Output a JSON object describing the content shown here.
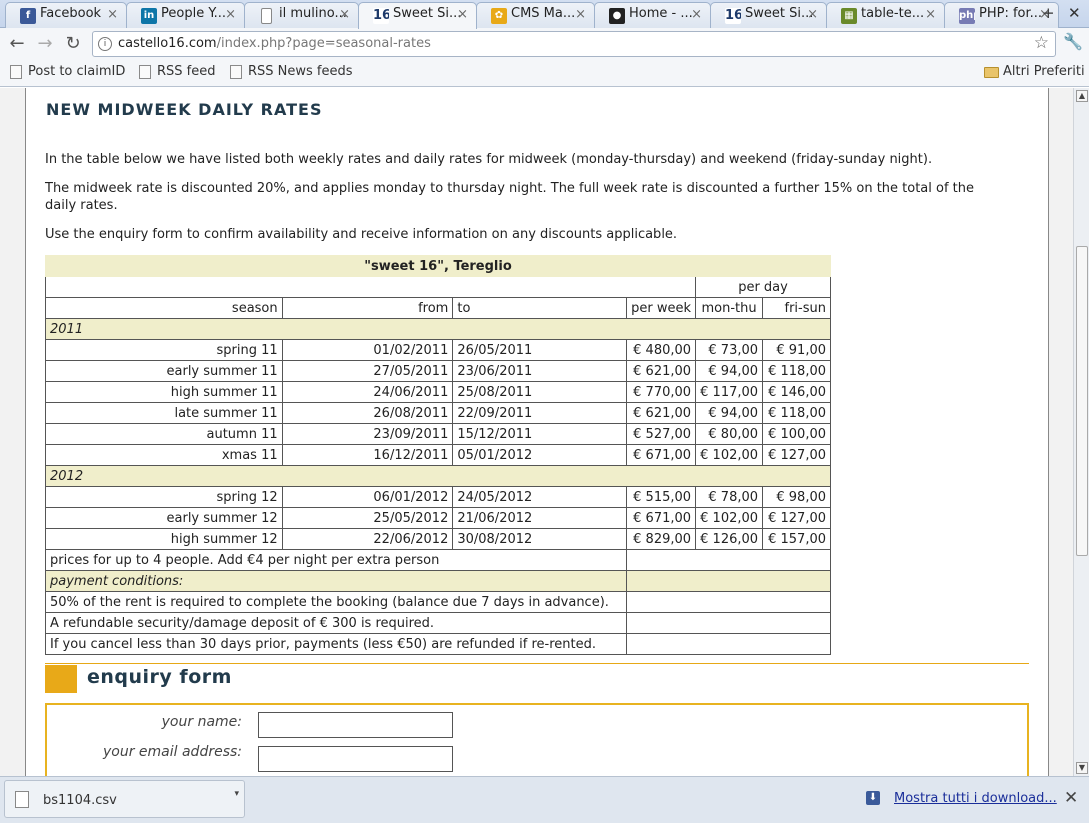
{
  "tabs": [
    {
      "label": "Facebook",
      "icon": "facebook-icon",
      "color": "#3b5998",
      "glyph": "f"
    },
    {
      "label": "People Y...",
      "icon": "linkedin-icon",
      "color": "#0e76a8",
      "glyph": "in"
    },
    {
      "label": "il mulino...",
      "icon": "page-icon",
      "color": "#ffffff",
      "glyph": ""
    },
    {
      "label": "Sweet Si...",
      "icon": "sweet16-icon",
      "color": "#ffffff",
      "glyph": "16"
    },
    {
      "label": "CMS Ma...",
      "icon": "cms-icon",
      "color": "#e8a918",
      "glyph": "✿"
    },
    {
      "label": "Home - ...",
      "icon": "github-icon",
      "color": "#222222",
      "glyph": "●"
    },
    {
      "label": "Sweet Si...",
      "icon": "sweet16-icon",
      "color": "#ffffff",
      "glyph": "16"
    },
    {
      "label": "table-te...",
      "icon": "game-icon",
      "color": "#6a8a2a",
      "glyph": "▦"
    },
    {
      "label": "PHP: for...",
      "icon": "php-icon",
      "color": "#777bb4",
      "glyph": "php"
    }
  ],
  "url": {
    "host": "castello16.com",
    "path": "/index.php?page=seasonal-rates"
  },
  "bookmarks": {
    "items": [
      "Post to claimID",
      "RSS feed",
      "RSS News feeds"
    ],
    "other": "Altri Preferiti"
  },
  "page": {
    "heading": "NEW MIDWEEK DAILY RATES",
    "para1": "In the table below we have listed both weekly rates and daily rates for midweek (monday-thursday) and weekend (friday-sunday night).",
    "para2": "The midweek rate is discounted 20%, and applies monday to thursday night. The full week rate is discounted a further 15% on the total of the daily rates.",
    "para3": "Use the enquiry form to confirm availability and receive information on any discounts applicable."
  },
  "table": {
    "title": "\"sweet 16\", Tereglio",
    "per_day": "per day",
    "headers": [
      "season",
      "from",
      "to",
      "per week",
      "mon-thu",
      "fri-sun"
    ],
    "groups": [
      {
        "year": "2011",
        "rows": [
          [
            "spring 11",
            "01/02/2011",
            "26/05/2011",
            "€ 480,00",
            "€ 73,00",
            "€ 91,00"
          ],
          [
            "early summer 11",
            "27/05/2011",
            "23/06/2011",
            "€ 621,00",
            "€ 94,00",
            "€ 118,00"
          ],
          [
            "high summer 11",
            "24/06/2011",
            "25/08/2011",
            "€ 770,00",
            "€ 117,00",
            "€ 146,00"
          ],
          [
            "late summer 11",
            "26/08/2011",
            "22/09/2011",
            "€ 621,00",
            "€ 94,00",
            "€ 118,00"
          ],
          [
            "autumn 11",
            "23/09/2011",
            "15/12/2011",
            "€ 527,00",
            "€ 80,00",
            "€ 100,00"
          ],
          [
            "xmas 11",
            "16/12/2011",
            "05/01/2012",
            "€ 671,00",
            "€ 102,00",
            "€ 127,00"
          ]
        ]
      },
      {
        "year": "2012",
        "rows": [
          [
            "spring 12",
            "06/01/2012",
            "24/05/2012",
            "€ 515,00",
            "€ 78,00",
            "€ 98,00"
          ],
          [
            "early summer 12",
            "25/05/2012",
            "21/06/2012",
            "€ 671,00",
            "€ 102,00",
            "€ 127,00"
          ],
          [
            "high summer 12",
            "22/06/2012",
            "30/08/2012",
            "€ 829,00",
            "€ 126,00",
            "€ 157,00"
          ]
        ]
      }
    ],
    "note": "prices for up to 4 people. Add €4 per night per extra person",
    "payment_title": "payment conditions:",
    "payment": [
      "50% of the rent is required to complete the booking (balance due 7 days in advance).",
      "A refundable security/damage deposit of € 300 is required.",
      "If you cancel less than 30 days prior, payments (less €50) are refunded if re-rented."
    ]
  },
  "enquiry": {
    "title": "enquiry form",
    "name_label": "your name:",
    "email_label": "your email address:"
  },
  "download": {
    "file": "bs1104.csv",
    "show_all": "Mostra tutti i download..."
  }
}
